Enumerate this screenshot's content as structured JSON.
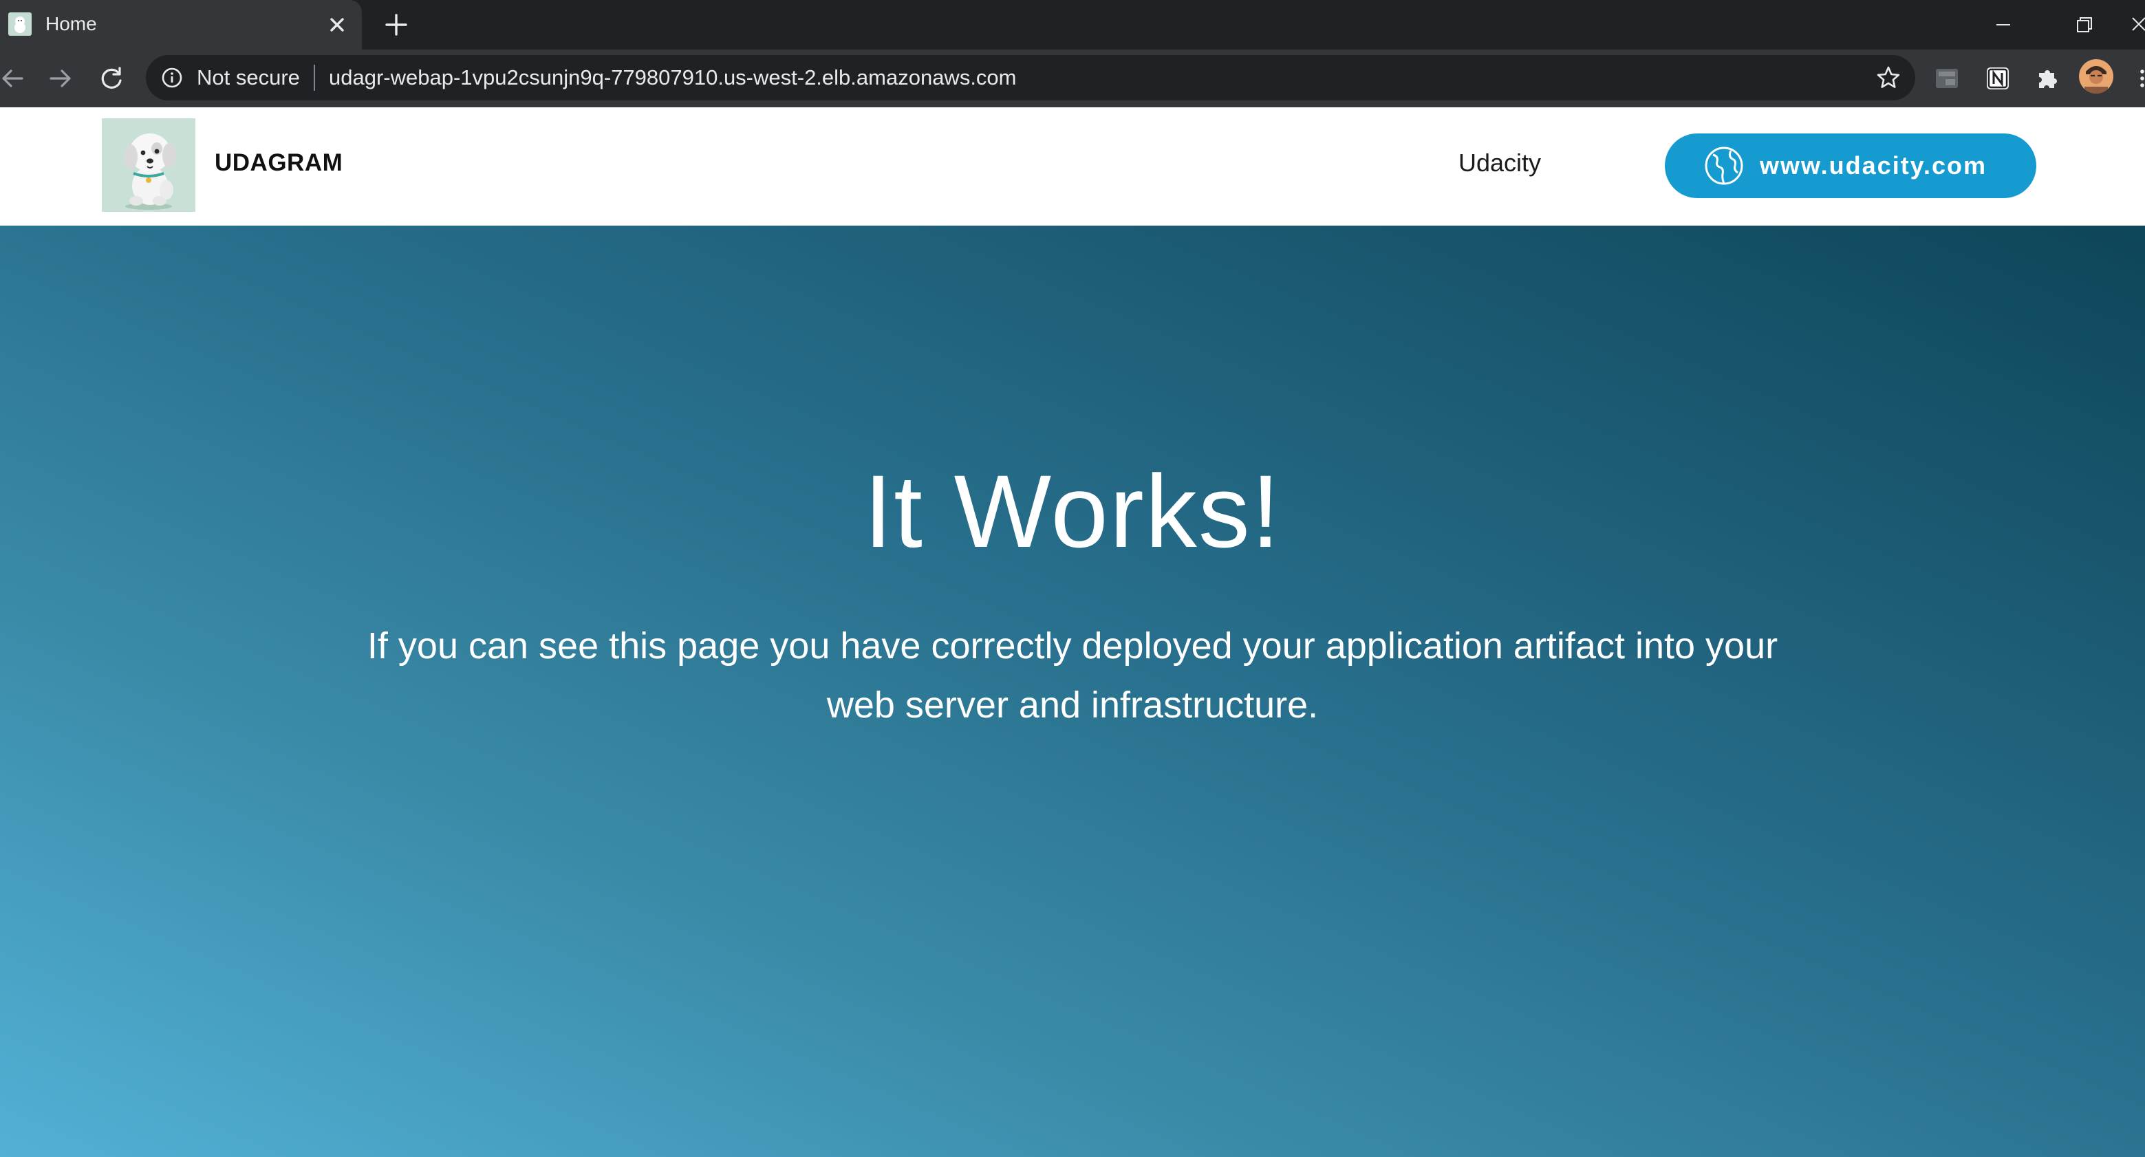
{
  "browser": {
    "tab": {
      "title": "Home"
    },
    "address_bar": {
      "security_label": "Not secure",
      "url": "udagr-webap-1vpu2csunjn9q-779807910.us-west-2.elb.amazonaws.com"
    }
  },
  "navbar": {
    "brand": "UDAGRAM",
    "link": "Udacity",
    "cta_label": "www.udacity.com"
  },
  "hero": {
    "title": "It Works!",
    "text": "If you can see this page you have correctly deployed your application artifact into your web server and infrastructure."
  },
  "colors": {
    "cta": "#169bd0",
    "hero_gradient_start": "#52b1d6",
    "hero_gradient_end": "#0e4558",
    "chrome_dark": "#202124",
    "chrome_toolbar": "#35363a"
  },
  "icons": {
    "tab_favicon": "dog-icon",
    "tab_close": "close-icon",
    "new_tab": "plus-icon",
    "minimize": "minimize-icon",
    "restore": "restore-icon",
    "close_window": "close-icon",
    "back": "arrow-left-icon",
    "forward": "arrow-right-icon",
    "reload": "reload-icon",
    "info": "info-icon",
    "bookmark": "star-icon",
    "extension_1": "extension-box-icon",
    "extension_2": "notion-icon",
    "extensions": "puzzle-icon",
    "profile": "avatar",
    "menu": "menu-dots-icon",
    "brand_logo": "dog-icon",
    "cta": "globe-icon"
  }
}
